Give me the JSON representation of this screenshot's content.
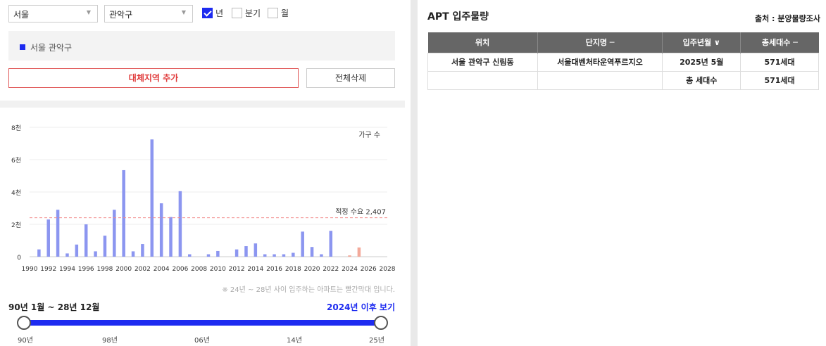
{
  "filters": {
    "city": "서울",
    "district": "관악구",
    "period_options": [
      {
        "label": "년",
        "checked": true
      },
      {
        "label": "분기",
        "checked": false
      },
      {
        "label": "월",
        "checked": false
      }
    ]
  },
  "selected_region": "서울 관악구",
  "buttons": {
    "add_region": "대체지역 추가",
    "delete_all": "전체삭제"
  },
  "chart_data": {
    "type": "bar",
    "title": "가구 수",
    "ylim": [
      0,
      8000
    ],
    "y_ticks": [
      "0",
      "2천",
      "4천",
      "6천",
      "8천"
    ],
    "x_ticks": [
      "1990",
      "1992",
      "1994",
      "1996",
      "1998",
      "2000",
      "2002",
      "2004",
      "2006",
      "2008",
      "2010",
      "2012",
      "2014",
      "2016",
      "2018",
      "2020",
      "2022",
      "2024",
      "2026",
      "2028"
    ],
    "x": [
      1991,
      1992,
      1993,
      1994,
      1995,
      1996,
      1997,
      1998,
      1999,
      2000,
      2001,
      2002,
      2003,
      2004,
      2005,
      2006,
      2007,
      2009,
      2010,
      2012,
      2013,
      2014,
      2015,
      2016,
      2017,
      2018,
      2019,
      2020,
      2021,
      2022,
      2024,
      2025
    ],
    "values": [
      450,
      2300,
      2900,
      200,
      750,
      2000,
      330,
      1300,
      2900,
      5350,
      330,
      780,
      7250,
      3300,
      2450,
      4050,
      150,
      150,
      350,
      450,
      650,
      820,
      150,
      150,
      150,
      240,
      1550,
      600,
      150,
      1600,
      80,
      571
    ],
    "future_from": 2024,
    "colors": {
      "past": "#8c96f0",
      "future": "#f3a99a",
      "reference": "#f28a8a"
    },
    "reference_line": {
      "value": 2407,
      "label": "적정 수요 2,407"
    },
    "grid": true
  },
  "chart_note": "※ 24년 ~ 28년 사이 입주하는 아파트는 빨간막대 입니다.",
  "range": {
    "label": "90년 1월 ~ 28년 12월",
    "after_link": "2024년 이후 보기",
    "ticks": [
      "90년",
      "98년",
      "06년",
      "14년",
      "25년"
    ]
  },
  "apt": {
    "title": "APT 입주물량",
    "source": "출처 : 분양물량조사",
    "columns": [
      "위치",
      "단지명 ─",
      "입주년월 ∨",
      "총세대수 ─"
    ],
    "rows": [
      [
        "서울 관악구 신림동",
        "서울대벤처타운역푸르지오",
        "2025년 5월",
        "571세대"
      ],
      [
        "",
        "",
        "총 세대수",
        "571세대"
      ]
    ]
  },
  "colors": {
    "accent": "#1d2bf0",
    "danger": "#e03a3a"
  }
}
